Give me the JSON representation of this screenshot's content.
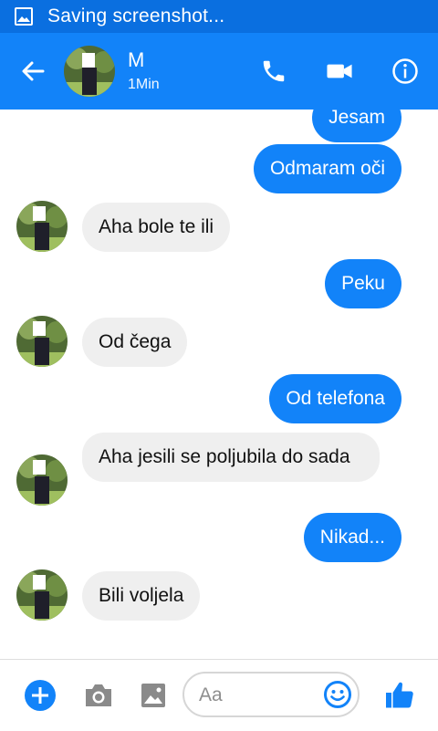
{
  "status_bar": {
    "icon": "image-icon",
    "text": "Saving screenshot..."
  },
  "header": {
    "back_icon": "arrow-left-icon",
    "contact_name": "M",
    "active_status": "1Min",
    "actions": [
      "phone-icon",
      "video-camera-icon",
      "info-icon"
    ]
  },
  "colors": {
    "accent": "#1283f9",
    "status_bar": "#0a6fe0",
    "incoming_bubble": "#efefef"
  },
  "messages": [
    {
      "direction": "outgoing",
      "text": "Jesam"
    },
    {
      "direction": "outgoing",
      "text": "Odmaram oči"
    },
    {
      "direction": "incoming",
      "text": "Aha bole te ili"
    },
    {
      "direction": "outgoing",
      "text": "Peku"
    },
    {
      "direction": "incoming",
      "text": "Od čega"
    },
    {
      "direction": "outgoing",
      "text": "Od telefona"
    },
    {
      "direction": "incoming",
      "text": "Aha jesili se poljubila do sada"
    },
    {
      "direction": "outgoing",
      "text": "Nikad..."
    },
    {
      "direction": "incoming",
      "text": "Bili voljela"
    }
  ],
  "composer": {
    "buttons": [
      "plus-icon",
      "camera-icon",
      "gallery-icon",
      "emoji-icon",
      "thumbs-up-icon"
    ],
    "placeholder": "Aa"
  }
}
